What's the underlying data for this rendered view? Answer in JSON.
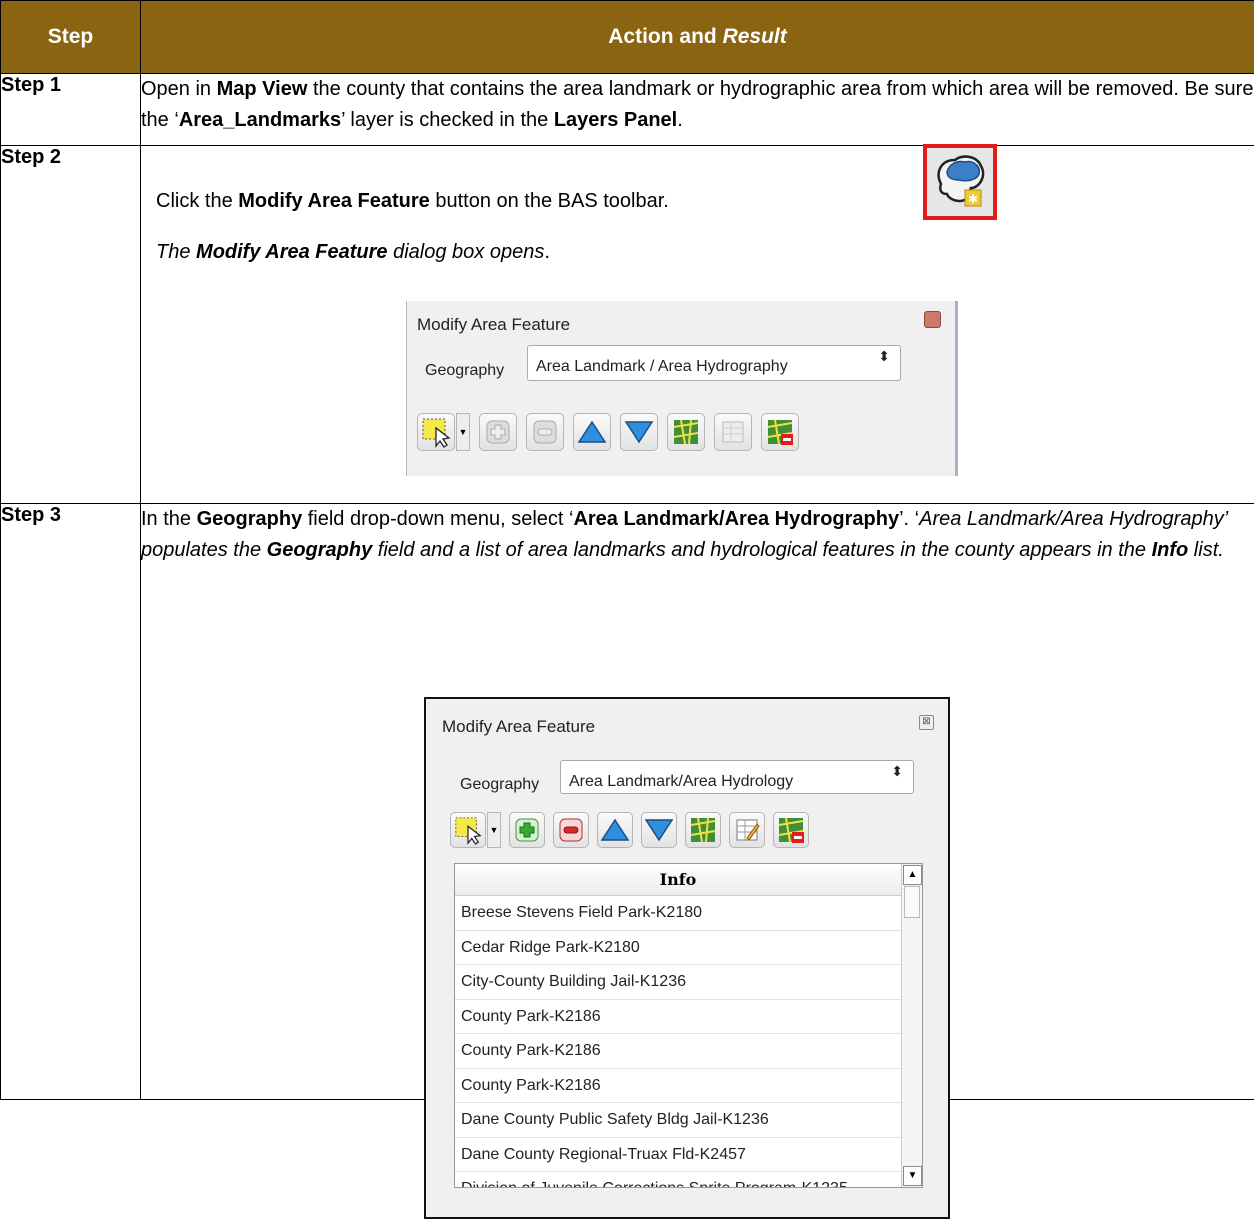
{
  "header": {
    "step": "Step",
    "action": "Action and ",
    "result": "Result"
  },
  "step1": {
    "label": "Step 1",
    "t1": "Open in ",
    "b1": "Map View",
    "t2": " the county that contains the area landmark or hydrographic area from which area will be removed. Be sure the ‘",
    "b2": "Area_Landmarks",
    "t3": "’ layer is checked in the ",
    "b3": "Layers Panel",
    "t4": "."
  },
  "step2": {
    "label": "Step 2",
    "t1": "Click the ",
    "b1": "Modify Area Feature",
    "t2": " button on the BAS toolbar.",
    "r1": "The ",
    "rb": "Modify Area Feature",
    "r2": " dialog box opens",
    "r3": "."
  },
  "dialog1": {
    "title": "Modify Area Feature",
    "geo_label": "Geography",
    "geo_value": "Area Landmark / Area Hydrography",
    "select_arrow": "⬍"
  },
  "step3": {
    "label": "Step 3",
    "t1": "In the ",
    "b1": "Geography",
    "t2": " field drop-down menu, select ‘",
    "b2": "Area Landmark/Area Hydrography",
    "t3": "’. ‘",
    "i1": "Area Landmark/Area Hydrography’ populates the ",
    "ib1": "Geography",
    "i2": " field and a list of area landmarks and hydrological features in the county appears in the ",
    "ib2": "Info",
    "i3": " list."
  },
  "dialog2": {
    "title": "Modify Area Feature",
    "close_glyph": "⊠",
    "geo_label": "Geography",
    "geo_value": "Area Landmark/Area Hydrology",
    "select_arrow": "⬍",
    "list_header": "Info",
    "items": [
      "Breese Stevens Field Park-K2180",
      "Cedar Ridge Park-K2180",
      "City-County Building Jail-K1236",
      "County Park-K2186",
      "County Park-K2186",
      "County Park-K2186",
      "Dane County Public Safety Bldg Jail-K1236",
      "Dane County Regional-Truax Fld-K2457",
      "Division of Juvenile Corrections Sprite Program-K1235"
    ],
    "scroll_up": "▲",
    "scroll_down": "▼"
  },
  "colors": {
    "header_bg": "#8a6410",
    "highlight": "#e21b1b"
  }
}
